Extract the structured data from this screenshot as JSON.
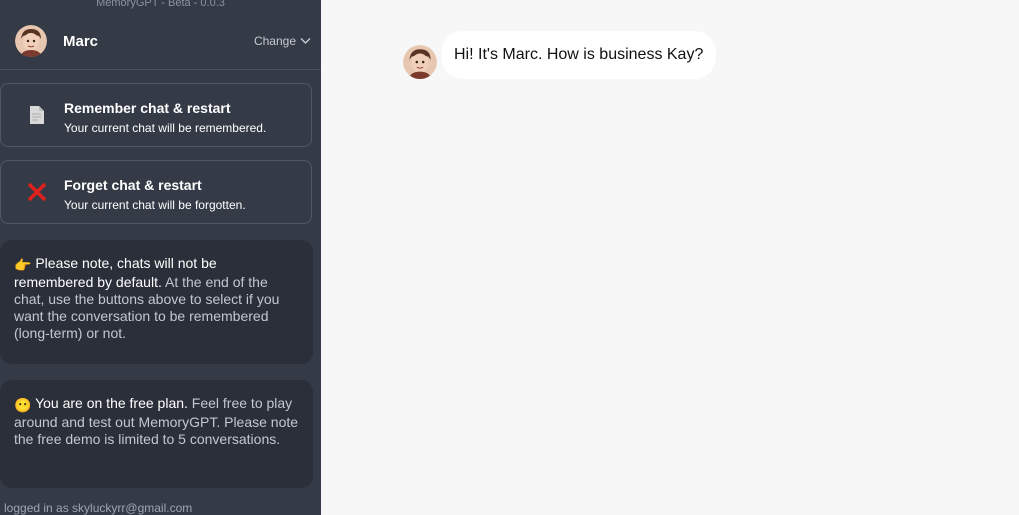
{
  "app": {
    "version_label": "MemoryGPT - Beta - 0.0.3"
  },
  "profile": {
    "name": "Marc",
    "change_label": "Change"
  },
  "actions": {
    "remember": {
      "title": "Remember chat & restart",
      "subtitle": "Your current chat will be remembered.",
      "icon": "document-icon"
    },
    "forget": {
      "title": "Forget chat & restart",
      "subtitle": "Your current chat will be forgotten.",
      "icon": "red-x-icon",
      "icon_color": "#e0201c"
    }
  },
  "notes": {
    "default_note": {
      "emoji": "👉",
      "strong": "Please note, chats will not be remembered by default.",
      "text": "At the end of the chat, use the buttons above to select if you want the conversation to be remembered (long-term) or not."
    },
    "plan_note": {
      "emoji": "😶",
      "strong": "You are on the free plan.",
      "text": "Feel free to play around and test out MemoryGPT. Please note the free demo is limited to 5 conversations."
    }
  },
  "footer": {
    "logged_in": "logged in as skyluckyrr@gmail.com"
  },
  "chat": {
    "messages": [
      {
        "sender": "Marc",
        "text": "Hi! It's Marc. How is business Kay?"
      }
    ]
  },
  "colors": {
    "sidebar_bg": "#343a46",
    "note_bg": "#2a2f3a",
    "main_bg": "#f7f7f7"
  }
}
